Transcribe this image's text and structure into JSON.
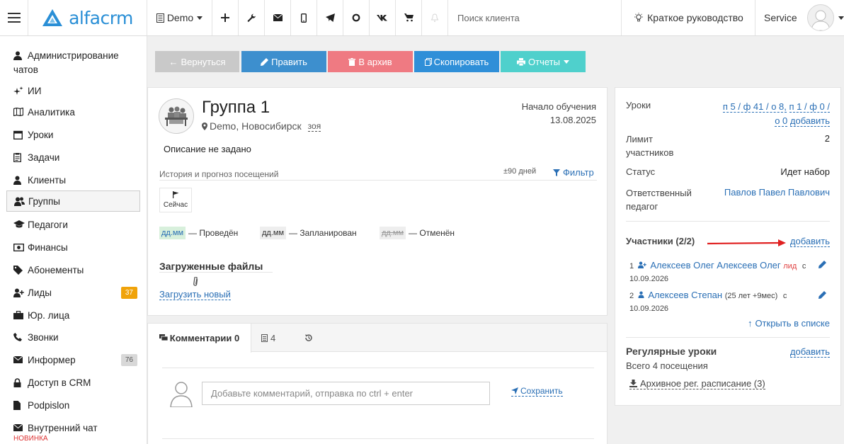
{
  "topbar": {
    "brand": "alfacrm",
    "branch": "Demo",
    "search_placeholder": "Поиск клиента",
    "guide_label": "Краткое руководство",
    "user_label": "Service"
  },
  "sidebar": {
    "items": [
      {
        "label": "Администрирование чатов",
        "icon": "user-admin-icon"
      },
      {
        "label": "ИИ",
        "icon": "sparkles-icon"
      },
      {
        "label": "Аналитика",
        "icon": "map-icon"
      },
      {
        "label": "Уроки",
        "icon": "calendar-icon"
      },
      {
        "label": "Задачи",
        "icon": "clipboard-icon"
      },
      {
        "label": "Клиенты",
        "icon": "user-icon"
      },
      {
        "label": "Группы",
        "icon": "users-icon"
      },
      {
        "label": "Педагоги",
        "icon": "graduation-cap-icon"
      },
      {
        "label": "Финансы",
        "icon": "money-icon"
      },
      {
        "label": "Абонементы",
        "icon": "tag-icon"
      },
      {
        "label": "Лиды",
        "icon": "user-plus-icon",
        "badge": "37"
      },
      {
        "label": "Юр. лица",
        "icon": "briefcase-icon"
      },
      {
        "label": "Звонки",
        "icon": "phone-icon"
      },
      {
        "label": "Информер",
        "icon": "envelope-icon",
        "badge": "76"
      },
      {
        "label": "Доступ в CRM",
        "icon": "lock-icon"
      },
      {
        "label": "Podpislon",
        "icon": "document-icon"
      },
      {
        "label": "Внутренний чат",
        "icon": "envelope-icon"
      }
    ],
    "new_label": "НОВИНКА"
  },
  "toolbar": {
    "back": "Вернуться",
    "edit": "Править",
    "archive": "В архив",
    "copy": "Скопировать",
    "reports": "Отчеты"
  },
  "group": {
    "title": "Группа 1",
    "location": "Demo, Новосибирск",
    "room": "зоя",
    "start_label": "Начало обучения",
    "start_date": "13.08.2025",
    "description": "Описание не задано",
    "history_label": "История и прогноз посещений",
    "range_label": "±90 дней",
    "filter_label": "Фильтр",
    "now_label": "Сейчас",
    "legend": [
      {
        "code": "дд.мм",
        "text": "— Проведён"
      },
      {
        "code": "дд.мм",
        "text": "— Запланирован"
      },
      {
        "code": "дд.мм",
        "text": "— Отменён"
      }
    ],
    "files_title": "Загруженные файлы",
    "upload_link": "Загрузить новый"
  },
  "comments": {
    "tab_comments": "Комментарии 0",
    "tab_tasks": "4",
    "placeholder": "Добавьте комментарий, отправка по ctrl + enter",
    "save_label": "Сохранить"
  },
  "details": {
    "lessons_label": "Уроки",
    "lessons_value_1": "п 5 / ф 41 / о 8,",
    "lessons_value_2": "п 1 / ф 0 /",
    "lessons_value_3": "о 0",
    "lessons_add": "добавить",
    "limit_label_1": "Лимит",
    "limit_label_2": "участников",
    "limit_value": "2",
    "status_label": "Статус",
    "status_value": "Идет набор",
    "teacher_label_1": "Ответственный",
    "teacher_label_2": "педагог",
    "teacher_value": "Павлов Павел Павлович",
    "participants_title": "Участники (2/2)",
    "participants_add": "добавить",
    "participants": [
      {
        "num": "1",
        "name": "Алексеев Олег Алексеев Олег",
        "tag": "лид",
        "from": "с",
        "date": "10.09.2026"
      },
      {
        "num": "2",
        "name": "Алексеев Степан",
        "extra": "(25 лет +9мес)",
        "from": "с",
        "date": "10.09.2026"
      }
    ],
    "open_list": "Открыть в списке",
    "regular_title": "Регулярные уроки",
    "regular_add": "добавить",
    "regular_count": "Всего 4 посещения",
    "archive_schedule": "Архивное рег. расписание (3)"
  },
  "colors": {
    "brand": "#2a8fd6",
    "back": "#c9c9c9",
    "edit": "#3d8fce",
    "archive": "#ef7a82",
    "copy": "#2f8fd8",
    "reports": "#4fd0cc",
    "badge_orange": "#f0a30a",
    "arrow_red": "#e02020"
  }
}
